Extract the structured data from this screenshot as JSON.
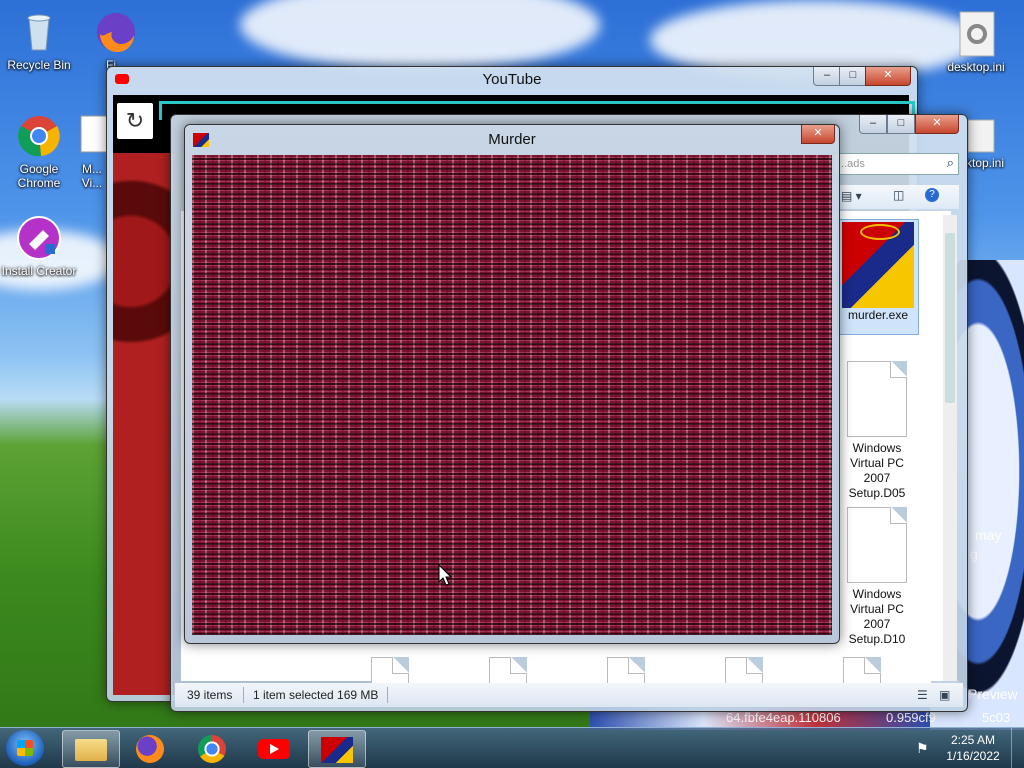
{
  "desktop": {
    "icons_left": [
      {
        "label": "Recycle Bin",
        "icon": "recycle-bin-icon"
      },
      {
        "label": "Fi...",
        "icon": "firefox-icon"
      },
      {
        "label": "Google Chrome",
        "icon": "chrome-icon"
      },
      {
        "label": "M... Vi...",
        "icon": "virtualpc-icon"
      },
      {
        "label": "Install Creator",
        "icon": "install-creator-icon"
      }
    ],
    "icons_right": [
      {
        "label": "desktop.ini",
        "icon": "settings-file-icon"
      },
      {
        "label": "...ktop.ini",
        "icon": "settings-file-icon"
      }
    ],
    "wallpaper_text": [
      "may",
      "g",
      "Preview",
      "64.fbfe4eap.110806",
      "0.959cf9",
      "5c03"
    ]
  },
  "youtube_window": {
    "title": "YouTube",
    "controls": {
      "minimize": "–",
      "maximize": "□",
      "close": "✕"
    }
  },
  "explorer_window": {
    "search_placeholder": "...ads",
    "files": [
      {
        "name": "murder.exe",
        "selected": true
      },
      {
        "name": "Windows Virtual PC 2007 Setup.D05"
      },
      {
        "name": "Windows Virtual PC 2007 Setup.D10"
      }
    ],
    "status": {
      "items": "39 items",
      "selected": "1 item selected 169 MB"
    }
  },
  "murder_window": {
    "title": "Murder",
    "close": "✕"
  },
  "taskbar": {
    "items": [
      {
        "name": "start-button",
        "icon": "windows-logo-icon"
      },
      {
        "name": "explorer",
        "icon": "folder-icon"
      },
      {
        "name": "firefox",
        "icon": "firefox-icon"
      },
      {
        "name": "chrome",
        "icon": "chrome-icon"
      },
      {
        "name": "youtube",
        "icon": "youtube-icon"
      },
      {
        "name": "murder",
        "icon": "murder-app-icon",
        "active": true
      }
    ],
    "clock": {
      "time": "2:25 AM",
      "date": "1/16/2022"
    }
  },
  "colors": {
    "static_base": "#7a1530",
    "taskbar": "#2a4468",
    "youtube_red": "#ff0000"
  }
}
